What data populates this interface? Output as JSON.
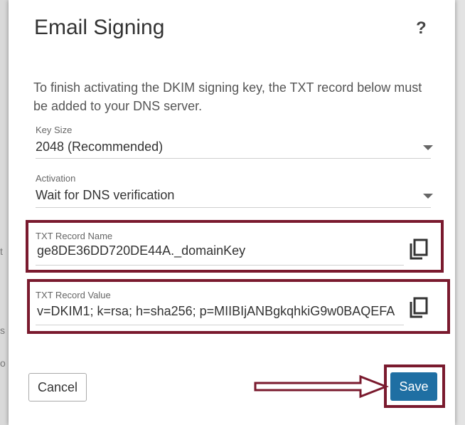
{
  "background": {
    "left_glyphs": [
      "t",
      "s",
      "o"
    ]
  },
  "dialog": {
    "title": "Email Signing",
    "help_label": "?",
    "description": "To finish activating the DKIM signing key, the TXT record below must be added to your DNS server.",
    "key_size": {
      "label": "Key Size",
      "value": "2048 (Recommended)"
    },
    "activation": {
      "label": "Activation",
      "value": "Wait for DNS verification"
    },
    "txt_record_name": {
      "label": "TXT Record Name",
      "value": "ge8DE36DD720DE44A._domainKey"
    },
    "txt_record_value": {
      "label": "TXT Record Value",
      "value": "v=DKIM1; k=rsa; h=sha256; p=MIIBIjANBgkqhkiG9w0BAQEFA"
    },
    "buttons": {
      "cancel": "Cancel",
      "save": "Save"
    }
  },
  "colors": {
    "highlight": "#7a1a2e",
    "primary": "#1f6fa3"
  },
  "icons": {
    "copy": "copy-icon",
    "dropdown": "chevron-down-icon",
    "annotation_arrow": "arrow-right-icon"
  }
}
